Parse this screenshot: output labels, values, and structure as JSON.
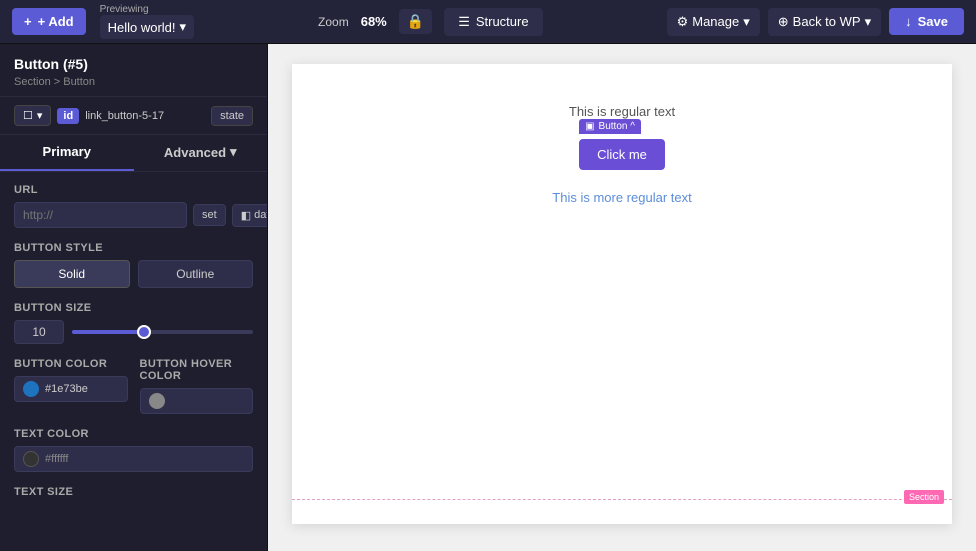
{
  "topbar": {
    "add_label": "+ Add",
    "previewing_label": "Previewing",
    "page_name": "Hello world!",
    "zoom_label": "Zoom",
    "zoom_value": "68%",
    "lock_icon": "🔒",
    "structure_label": "Structure",
    "manage_label": "Manage",
    "back_label": "Back to WP",
    "save_label": "Save",
    "chevron": "▾"
  },
  "sidebar": {
    "title": "Button (#5)",
    "breadcrumb": "Section > Button",
    "element_selector": "☐ ▾",
    "id_badge": "id",
    "id_value": "link_button-5-17",
    "state_label": "state",
    "tabs": {
      "primary": "Primary",
      "advanced": "Advanced"
    },
    "fields": {
      "url_label": "URL",
      "url_placeholder": "http://",
      "set_label": "set",
      "data_label": "data",
      "button_style_label": "Button Style",
      "solid_label": "Solid",
      "outline_label": "Outline",
      "button_size_label": "Button Size",
      "size_value": "10",
      "button_color_label": "Button Color",
      "button_color_value": "#1e73be",
      "button_hover_label": "Button Hover Color",
      "text_color_label": "Text Color",
      "text_color_value": "#ffffff",
      "text_size_label": "Text Size"
    }
  },
  "canvas": {
    "regular_text": "This is regular text",
    "button_label": "Click me",
    "button_toolbar_label": "Button ^",
    "more_text": "This is more regular text",
    "section_label": "Section"
  }
}
